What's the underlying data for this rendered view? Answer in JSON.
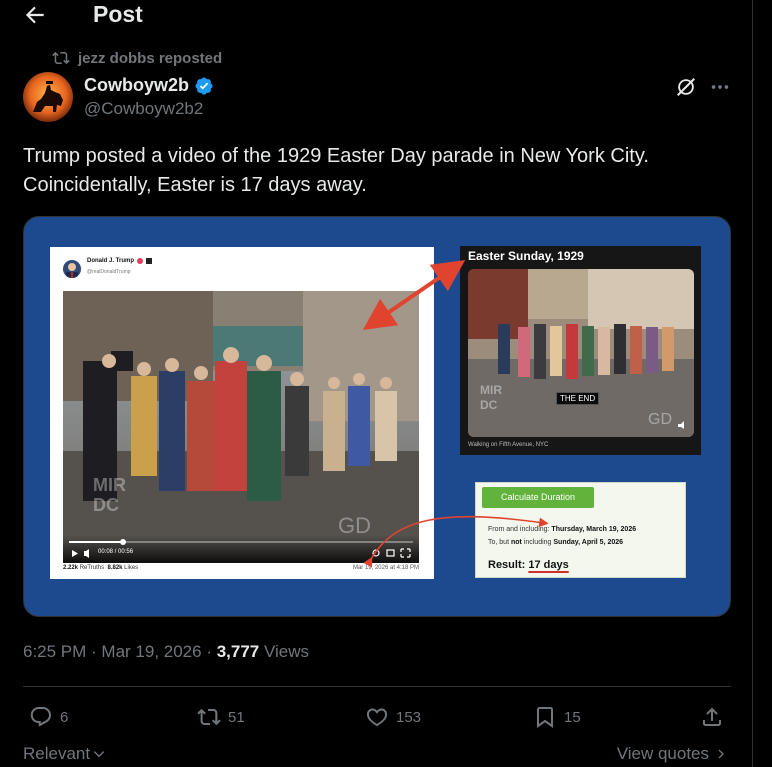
{
  "header": {
    "title": "Post"
  },
  "repost": {
    "text": "jezz dobbs reposted"
  },
  "author": {
    "name": "Cowboyw2b",
    "handle": "@Cowboyw2b2"
  },
  "tweet": {
    "line1": "Trump posted a video of the 1929 Easter Day parade in New York City.",
    "line2": "Coincidentally, Easter is 17 days away."
  },
  "media": {
    "truth_post": {
      "name": "Donald J. Trump",
      "handle": "@realDonaldTrump",
      "video_time": "00:08 / 00:56",
      "retruths_count": "2.22k",
      "retruths_label": "ReTruths",
      "likes_count": "8.82k",
      "likes_label": "Likes",
      "date": "Mar 19, 2026 at 4:18 PM"
    },
    "easter_card": {
      "title": "Easter Sunday, 1929",
      "end_text": "THE END",
      "caption": "Walking on Fifth Avenue, NYC"
    },
    "calculator": {
      "button": "Calculate Duration",
      "line1_prefix": "From and including: ",
      "line1_date": "Thursday, March 19, 2026",
      "line2_prefix": "To, but ",
      "line2_not": "not",
      "line2_mid": " including ",
      "line2_date": "Sunday, April 5, 2026",
      "result_label": "Result: ",
      "result_value": "17 days"
    },
    "accent_color": "#1d4a8f",
    "arrow_color": "#e0442e"
  },
  "meta": {
    "time": "6:25 PM",
    "sep1": " · ",
    "date": "Mar 19, 2026",
    "sep2": " · ",
    "views_count": "3,777",
    "views_label": " Views"
  },
  "actions": {
    "replies": "6",
    "reposts": "51",
    "likes": "153",
    "bookmarks": "15"
  },
  "footer": {
    "relevant": "Relevant",
    "view_quotes": "View quotes"
  },
  "colors": {
    "background": "#000000",
    "text": "#e7e9ea",
    "muted": "#71767b",
    "verified": "#1d9bf0"
  },
  "icons": [
    "back-arrow-icon",
    "repost-icon",
    "verified-badge-icon",
    "grok-icon",
    "more-icon",
    "reply-icon",
    "retweet-icon",
    "like-icon",
    "bookmark-icon",
    "share-icon",
    "chevron-down-icon",
    "chevron-right-icon"
  ]
}
